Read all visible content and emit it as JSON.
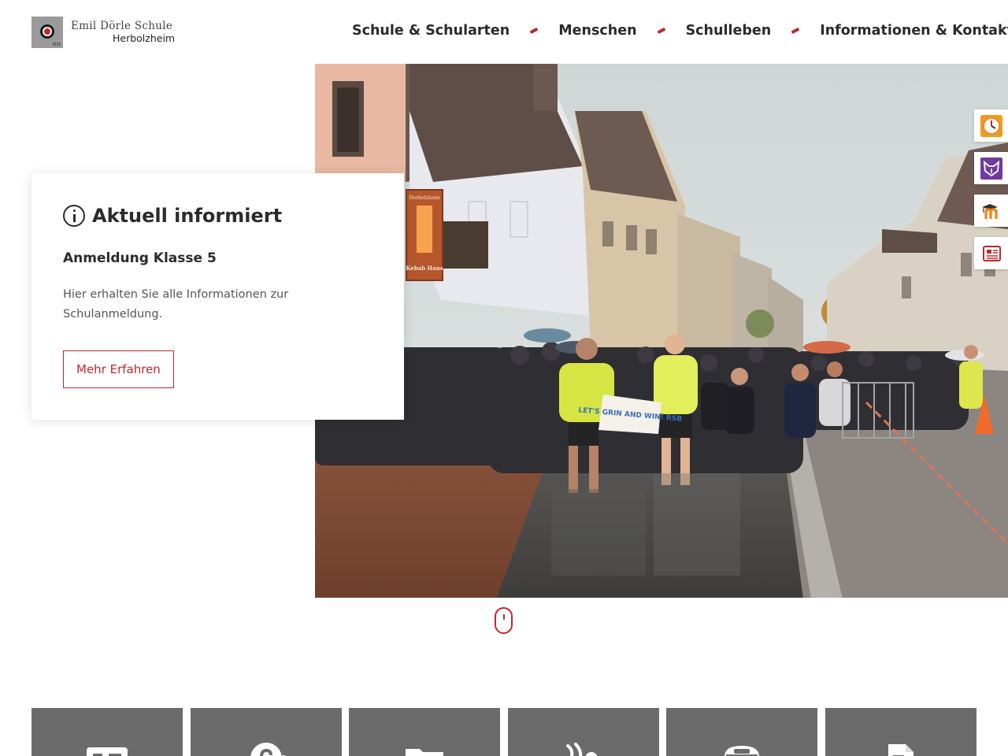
{
  "header": {
    "logo": {
      "name": "Emil Dörle Schule",
      "city": "Herbolzheim",
      "mark_caption": "EDS"
    },
    "nav": [
      {
        "label": "Schule & Schularten"
      },
      {
        "label": "Menschen"
      },
      {
        "label": "Schulleben"
      },
      {
        "label": "Informationen & Kontakt"
      }
    ]
  },
  "hero": {
    "image": "school-run-in-rain-photo",
    "signs": {
      "kebab_top": "Herbolzheim",
      "kebab_bottom": "Kebab Haus",
      "banner": "LET'S GRIN AND WIN! RSB"
    }
  },
  "info_card": {
    "icon": "info-icon",
    "title": "Aktuell informiert",
    "subtitle": "Anmeldung Klasse 5",
    "text": "Hier erhalten Sie alle Informationen zur Schulanmeldung.",
    "button_label": "Mehr Erfahren"
  },
  "side_links": [
    {
      "icon": "clock-icon",
      "color": "#f39a1e"
    },
    {
      "icon": "fox-icon",
      "color": "#6f3c9e"
    },
    {
      "icon": "moodle-icon",
      "color": "#f98012"
    },
    {
      "icon": "newspaper-icon",
      "color": "#c0272d"
    }
  ],
  "tiles": [
    {
      "icon": "id-card-icon"
    },
    {
      "icon": "help-icon"
    },
    {
      "icon": "folder-icon"
    },
    {
      "icon": "running-icon"
    },
    {
      "icon": "phone-icon"
    },
    {
      "icon": "document-icon"
    }
  ],
  "colors": {
    "accent": "#c0272d",
    "tile_bg": "#6b6b6b",
    "text": "#2b2b2b"
  }
}
